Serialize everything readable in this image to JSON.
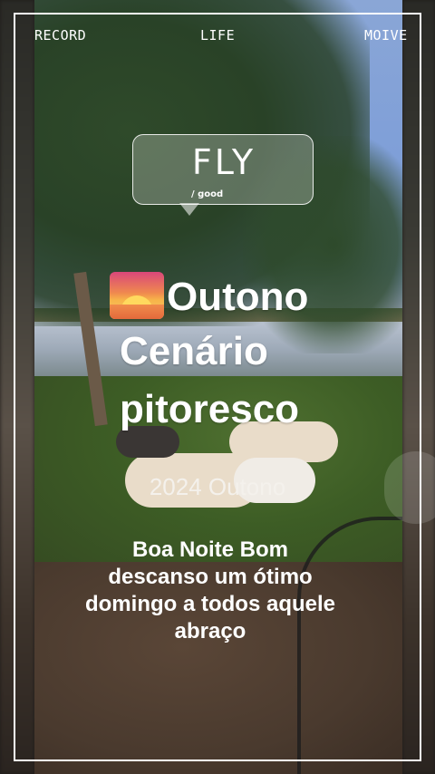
{
  "top_labels": {
    "left": "RECORD",
    "center": "LIFE",
    "right": "MOIVE"
  },
  "bubble": {
    "title": "FLY",
    "subtitle": "/ good"
  },
  "heading": {
    "icon": "sunset-icon",
    "line1": "Outono",
    "line2": "Cenário",
    "line3": "pitoresco"
  },
  "year_caption": "2024 Outono",
  "message": "Boa Noite Bom descanso um ótimo domingo a todos aquele abraço",
  "colors": {
    "frame": "#ffffff",
    "text": "#ffffff"
  }
}
